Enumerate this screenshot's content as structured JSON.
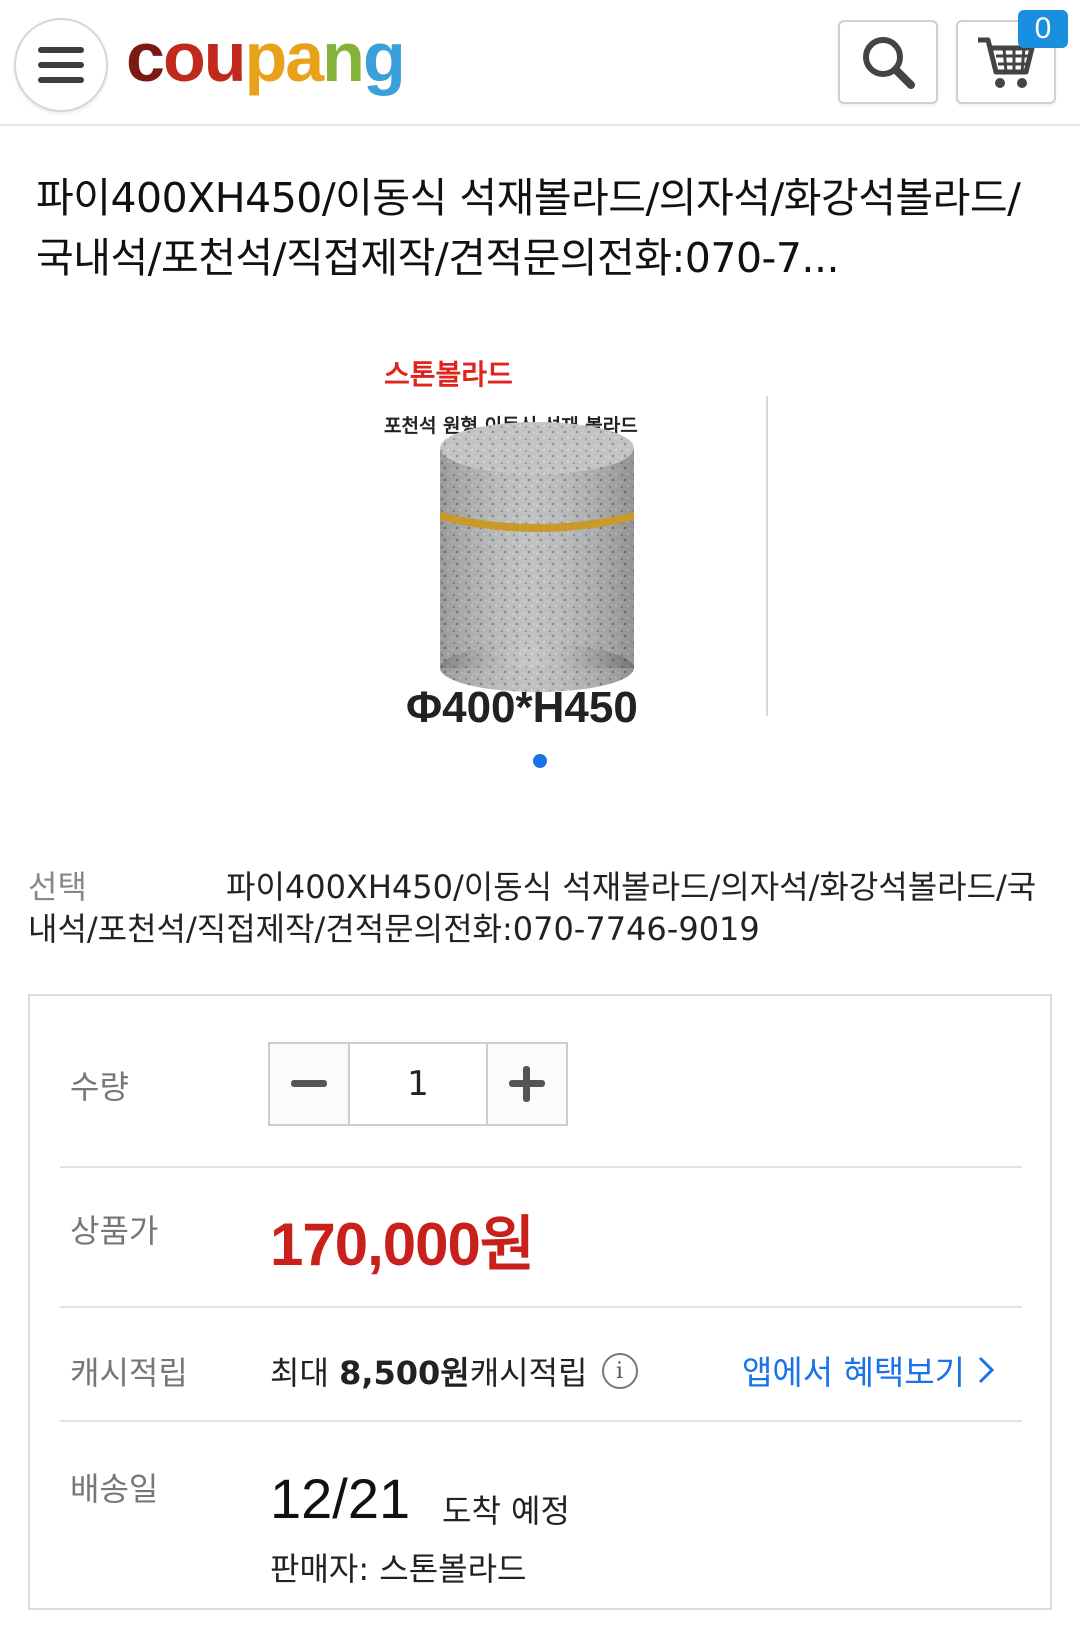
{
  "header": {
    "logo_parts": [
      "c",
      "ou",
      "pa",
      "n",
      "g"
    ],
    "cart_count": "0"
  },
  "product": {
    "title": "파이400XH450/이동식 석재볼라드/의자석/화강석볼라드/국내석/포천석/직접제작/견적문의전화:070-7...",
    "image": {
      "brand_text": "스톤볼라드",
      "subtitle_text": "포천석 원형 이동식 석재 볼라드",
      "dimension_text": "Φ400*H450"
    },
    "option_label": "선택",
    "option_value": "파이400XH450/이동식 석재볼라드/의자석/화강석볼라드/국내석/포천석/직접제작/견적문의전화:070-7746-9019"
  },
  "info": {
    "quantity_label": "수량",
    "quantity_value": "1",
    "price_label": "상품가",
    "price_value": "170,000원",
    "cash_label": "캐시적립",
    "cash_prefix": "최대 ",
    "cash_amount": "8,500원",
    "cash_suffix": " 캐시적립",
    "app_benefit": "앱에서 혜택보기",
    "delivery_label": "배송일",
    "delivery_date": "12/21",
    "delivery_suffix": "도착 예정",
    "seller": "판매자: 스톤볼라드"
  },
  "colors": {
    "price": "#c8201a",
    "link": "#1a73e8",
    "badge": "#1a8fe0"
  }
}
